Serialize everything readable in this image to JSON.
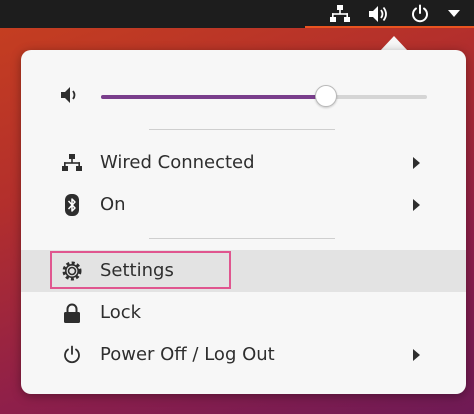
{
  "topbar": {
    "icons": [
      "network-wired-icon",
      "volume-icon",
      "power-icon",
      "dropdown-arrow-icon"
    ],
    "accent_color": "#e95420"
  },
  "volume": {
    "level": 0.69,
    "fill_color": "#7a3e8c",
    "icon": "volume-icon"
  },
  "menu": {
    "items": [
      {
        "label": "Wired Connected",
        "icon": "network-wired-icon",
        "has_submenu": true
      },
      {
        "label": "On",
        "icon": "bluetooth-icon",
        "has_submenu": true
      },
      {
        "label": "Settings",
        "icon": "settings-gear-icon",
        "has_submenu": false,
        "highlighted": true
      },
      {
        "label": "Lock",
        "icon": "lock-icon",
        "has_submenu": false
      },
      {
        "label": "Power Off / Log Out",
        "icon": "power-icon",
        "has_submenu": true
      }
    ],
    "highlight_color": "#e0568f"
  }
}
